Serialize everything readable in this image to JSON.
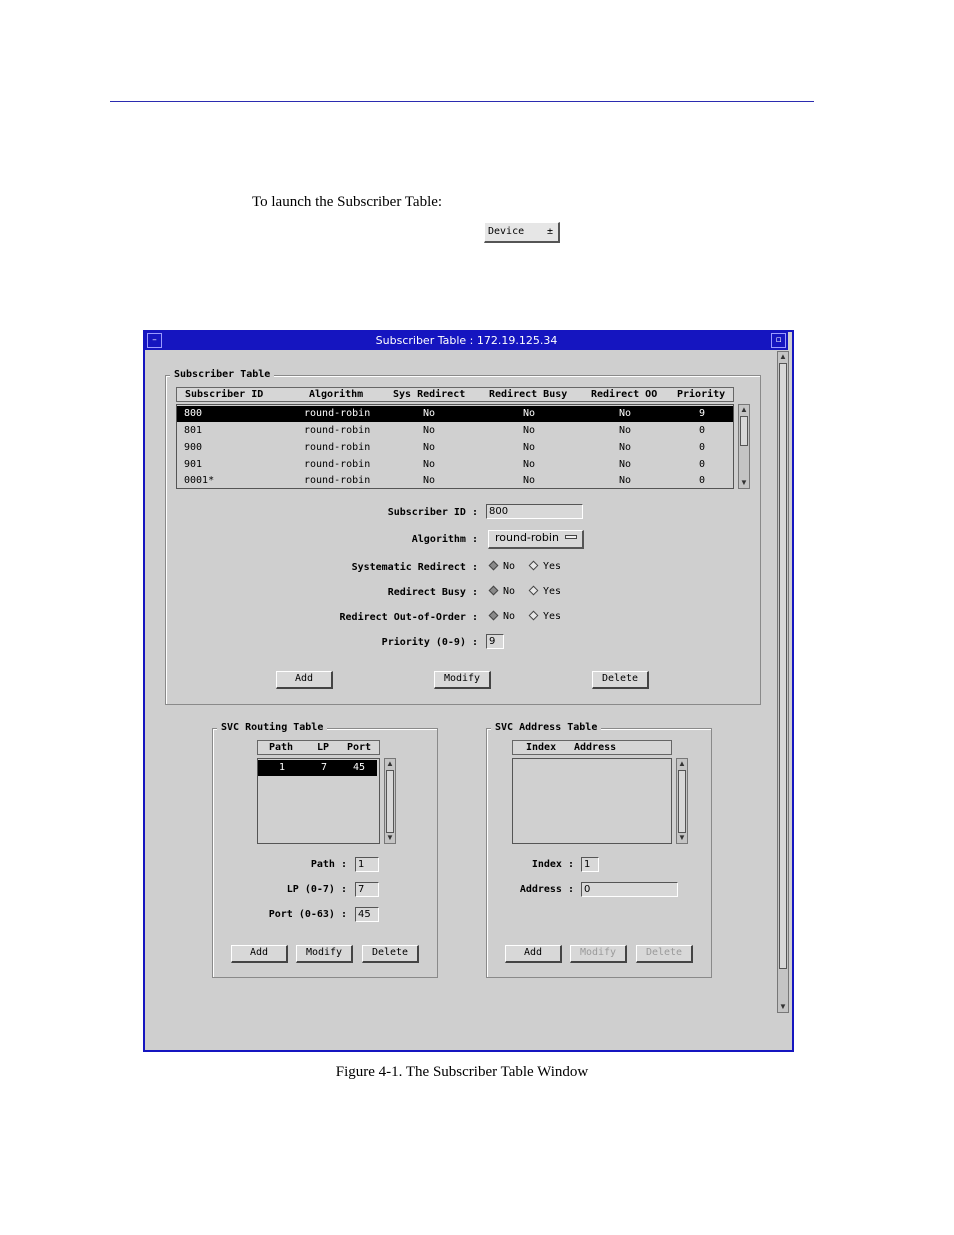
{
  "intro_text": "To launch the Subscriber Table:",
  "device_button": {
    "label": "Device",
    "arrow": "±"
  },
  "window": {
    "title": "Subscriber Table : 172.19.125.34",
    "subscriber_group": {
      "title": "Subscriber Table",
      "columns": [
        "Subscriber ID",
        "Algorithm",
        "Sys Redirect",
        "Redirect Busy",
        "Redirect OO",
        "Priority"
      ],
      "rows": [
        {
          "id": "800",
          "algorithm": "round-robin",
          "sys_redirect": "No",
          "redirect_busy": "No",
          "redirect_oo": "No",
          "priority": "9"
        },
        {
          "id": "801",
          "algorithm": "round-robin",
          "sys_redirect": "No",
          "redirect_busy": "No",
          "redirect_oo": "No",
          "priority": "0"
        },
        {
          "id": "900",
          "algorithm": "round-robin",
          "sys_redirect": "No",
          "redirect_busy": "No",
          "redirect_oo": "No",
          "priority": "0"
        },
        {
          "id": "901",
          "algorithm": "round-robin",
          "sys_redirect": "No",
          "redirect_busy": "No",
          "redirect_oo": "No",
          "priority": "0"
        },
        {
          "id": "0001*",
          "algorithm": "round-robin",
          "sys_redirect": "No",
          "redirect_busy": "No",
          "redirect_oo": "No",
          "priority": "0"
        }
      ],
      "form": {
        "subscriber_id_label": "Subscriber ID :",
        "subscriber_id_value": "800",
        "algorithm_label": "Algorithm :",
        "algorithm_value": "round-robin",
        "systematic_redirect_label": "Systematic Redirect :",
        "redirect_busy_label": "Redirect Busy :",
        "redirect_ooo_label": "Redirect Out-of-Order :",
        "priority_label": "Priority (0-9) :",
        "priority_value": "9",
        "no_label": "No",
        "yes_label": "Yes"
      },
      "buttons": {
        "add": "Add",
        "modify": "Modify",
        "delete": "Delete"
      }
    },
    "svc_routing": {
      "title": "SVC Routing Table",
      "columns": [
        "Path",
        "LP",
        "Port"
      ],
      "rows": [
        {
          "path": "1",
          "lp": "7",
          "port": "45"
        }
      ],
      "path_label": "Path :",
      "path_value": "1",
      "lp_label": "LP (0-7) :",
      "lp_value": "7",
      "port_label": "Port (0-63) :",
      "port_value": "45",
      "buttons": {
        "add": "Add",
        "modify": "Modify",
        "delete": "Delete"
      }
    },
    "svc_address": {
      "title": "SVC Address Table",
      "columns": [
        "Index",
        "Address"
      ],
      "index_label": "Index :",
      "index_value": "1",
      "address_label": "Address :",
      "address_value": "0",
      "buttons": {
        "add": "Add",
        "modify": "Modify",
        "delete": "Delete"
      }
    }
  },
  "caption": "Figure 4-1.  The Subscriber Table Window"
}
